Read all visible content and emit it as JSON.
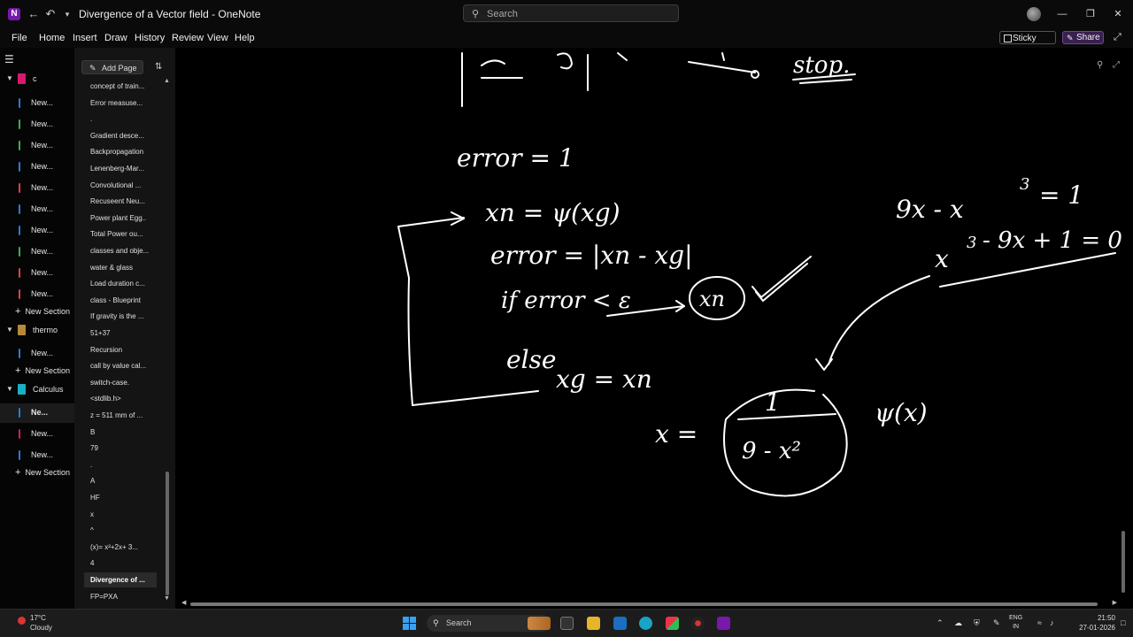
{
  "window": {
    "title": "Divergence of a Vector field - OneNote",
    "search_placeholder": "Search"
  },
  "menu": [
    "File",
    "Home",
    "Insert",
    "Draw",
    "History",
    "Review",
    "View",
    "Help"
  ],
  "toolbar": {
    "sticky_notes": "Sticky Notes",
    "share": "Share"
  },
  "notebooks": [
    {
      "label": "c",
      "color": "#d61a6b",
      "sections": [
        {
          "label": "New...",
          "color": "#2a7bd6"
        },
        {
          "label": "New...",
          "color": "#36b24a"
        },
        {
          "label": "New...",
          "color": "#36b24a"
        },
        {
          "label": "New...",
          "color": "#2a7bd6"
        },
        {
          "label": "New...",
          "color": "#e0404a"
        },
        {
          "label": "New...",
          "color": "#2a7bd6"
        },
        {
          "label": "New...",
          "color": "#2a7bd6"
        },
        {
          "label": "New...",
          "color": "#36b24a"
        },
        {
          "label": "New...",
          "color": "#e0404a"
        },
        {
          "label": "New...",
          "color": "#e0404a"
        }
      ]
    },
    {
      "label": "thermo",
      "color": "#b68a3a",
      "sections": [
        {
          "label": "New...",
          "color": "#2a7bd6"
        }
      ]
    },
    {
      "label": "Calculus",
      "color": "#1ab0c4",
      "sections": [
        {
          "label": "Ne...",
          "color": "#2a7bd6",
          "selected": true
        },
        {
          "label": "New...",
          "color": "#d61a6b"
        },
        {
          "label": "New...",
          "color": "#2a7bd6"
        }
      ]
    }
  ],
  "new_section_label": "New Section",
  "pages": {
    "add_page": "Add Page",
    "items": [
      "concept of train...",
      "Error measuse...",
      ".",
      "Gradient desce...",
      "Backpropagation",
      "Lenenberg-Mar...",
      "Convolutional ...",
      "Recuseent Neu...",
      "Power plant Egg..",
      "Total Power ou...",
      "classes and obje...",
      "water & glass",
      "Load duration c...",
      "class - Blueprint",
      "If gravity is the ...",
      "51+37",
      "Recursion",
      "call by value cal...",
      "switch-case.",
      "<stdlib.h>",
      "z = 511 mm of ...",
      "B",
      "79",
      ".",
      "A",
      "HF",
      "x",
      "^",
      "(x)= x²+2x+ 3...",
      "4",
      "Divergence of ...",
      "FP=PXA"
    ],
    "selected_index": 30
  },
  "canvas": {
    "ink_color": "#ffffff",
    "lines": {
      "top_stop": "stop.",
      "error_init": "error = 1",
      "xn_eq": "xn = ψ(xg)",
      "error_eq": "error = |xn - xg|",
      "if_line": "if error < ε",
      "xn_circled": "xn",
      "else_line": "else",
      "xg_eq": "xg = xn",
      "eq1_a": "9x - x",
      "eq1_exp": "3",
      "eq1_b": "= 1",
      "eq2_a": "x",
      "eq2_exp": "3",
      "eq2_b": "- 9x + 1 = 0",
      "x_eq": "x =",
      "frac_num": "1",
      "frac_den": "9 - x²",
      "psi": "ψ(x)"
    }
  },
  "taskbar": {
    "temp": "17°C",
    "condition": "Cloudy",
    "search": "Search",
    "lang": "ENG",
    "lang2": "IN",
    "time": "21:50",
    "date": "27-01-2026"
  }
}
